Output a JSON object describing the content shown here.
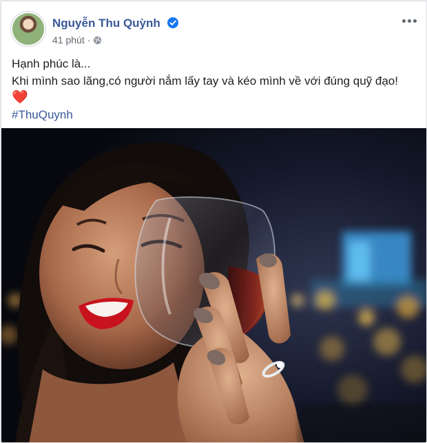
{
  "post": {
    "author": "Nguyễn Thu Quỳnh",
    "time": "41 phút",
    "separator": "·",
    "verified_icon": "verified-badge-icon",
    "privacy_icon": "globe-icon",
    "more_icon": "more-options-icon",
    "text_line1": "Hạnh phúc là...",
    "text_line2": "Khi mình sao lãng,có người nắm lấy tay và kéo mình về với đúng quỹ đạo!",
    "emoji": "❤️",
    "hashtag": "#ThuQuynh"
  },
  "colors": {
    "link": "#385898",
    "verified": "#1877f2",
    "heart": "#e8122a"
  }
}
